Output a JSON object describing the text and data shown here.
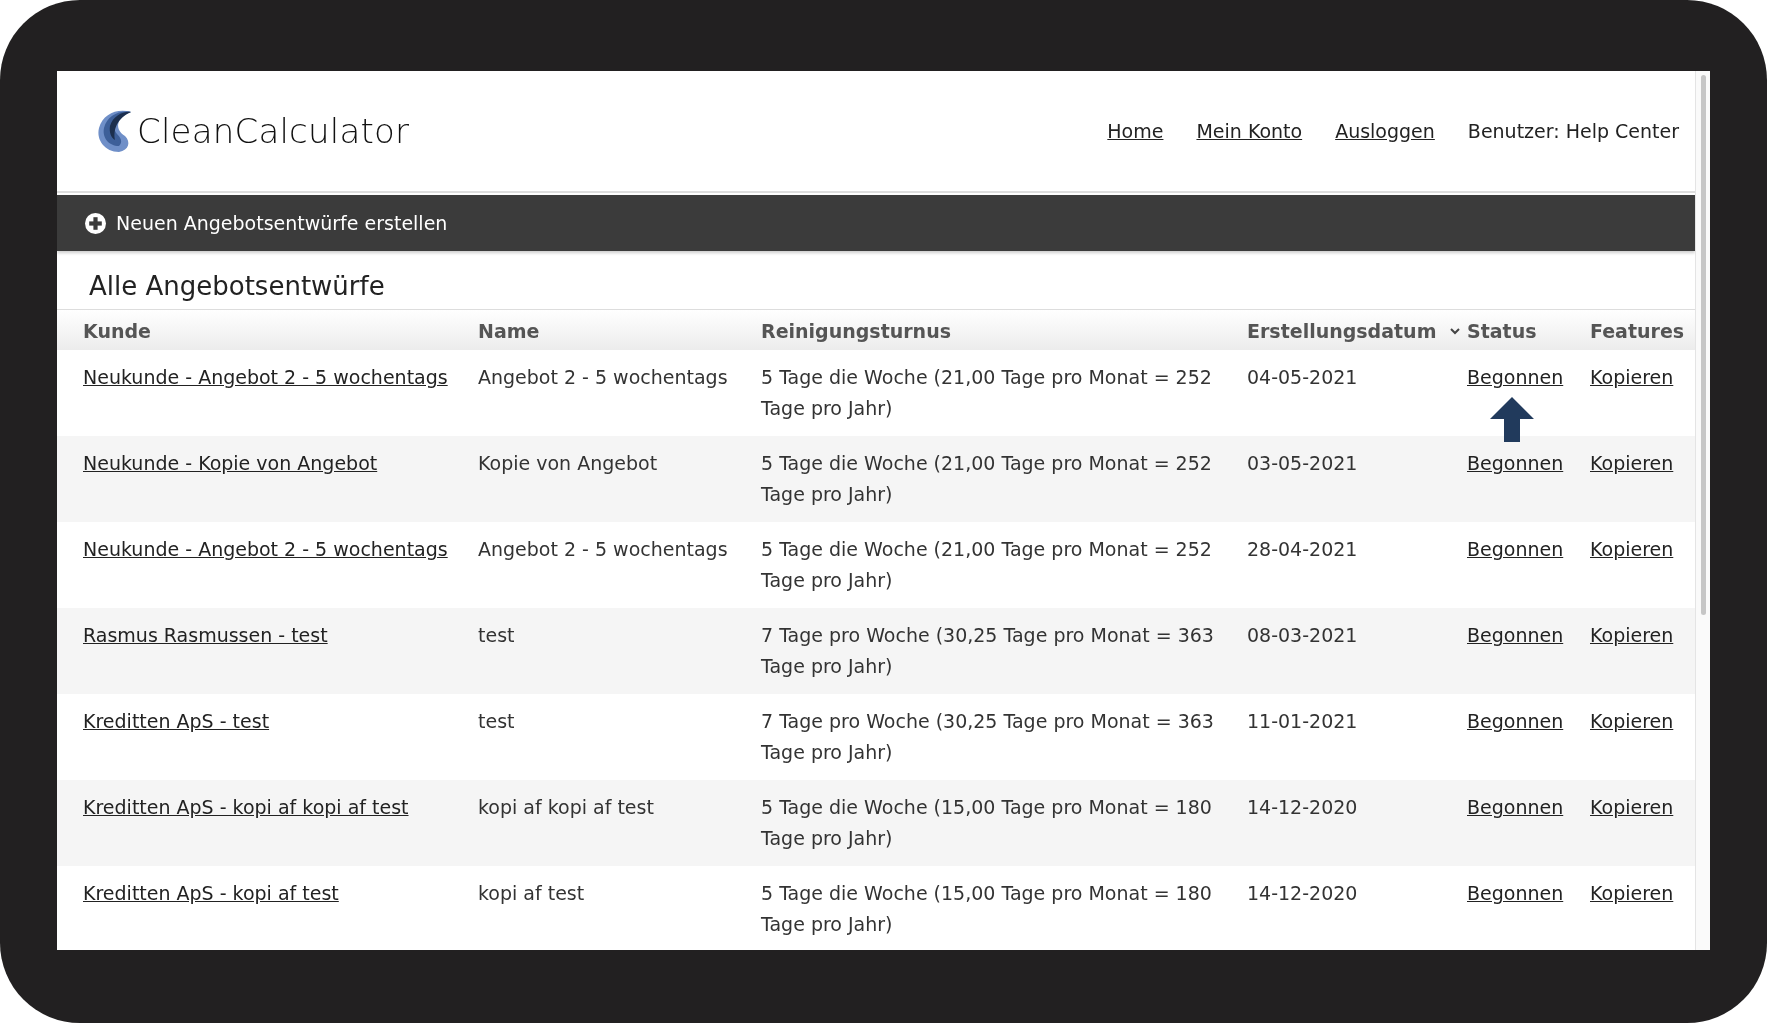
{
  "header": {
    "logo": "CleanCalculator",
    "nav": [
      "Home",
      "Mein Konto",
      "Ausloggen"
    ],
    "user": "Benutzer: Help Center"
  },
  "action_bar": {
    "label": "Neuen Angebotsentwürfe erstellen"
  },
  "section_title": "Alle Angebotsentwürfe",
  "table": {
    "columns": [
      {
        "label": "Kunde",
        "sorted": false
      },
      {
        "label": "Name",
        "sorted": false
      },
      {
        "label": "Reinigungsturnus",
        "sorted": false
      },
      {
        "label": "Erstellungsdatum",
        "sorted": true
      },
      {
        "label": "Status",
        "sorted": false
      },
      {
        "label": "Features",
        "sorted": false
      }
    ],
    "rows": [
      {
        "kunde": "Neukunde - Angebot 2 - 5 wochentags",
        "name": "Angebot 2 - 5 wochentags",
        "turnus": "5 Tage die Woche (21,00 Tage pro Monat = 252 Tage pro Jahr)",
        "datum": "04-05-2021",
        "status": "Begonnen",
        "feature": "Kopieren",
        "pointed": true
      },
      {
        "kunde": "Neukunde - Kopie von Angebot",
        "name": "Kopie von Angebot",
        "turnus": "5 Tage die Woche (21,00 Tage pro Monat = 252 Tage pro Jahr)",
        "datum": "03-05-2021",
        "status": "Begonnen",
        "feature": "Kopieren",
        "pointed": false
      },
      {
        "kunde": "Neukunde - Angebot 2 - 5 wochentags",
        "name": "Angebot 2 - 5 wochentags",
        "turnus": "5 Tage die Woche (21,00 Tage pro Monat = 252 Tage pro Jahr)",
        "datum": "28-04-2021",
        "status": "Begonnen",
        "feature": "Kopieren",
        "pointed": false
      },
      {
        "kunde": "Rasmus Rasmussen - test",
        "name": "test",
        "turnus": "7 Tage pro Woche (30,25 Tage pro Monat = 363 Tage pro Jahr)",
        "datum": "08-03-2021",
        "status": "Begonnen",
        "feature": "Kopieren",
        "pointed": false
      },
      {
        "kunde": "Kreditten ApS - test",
        "name": "test",
        "turnus": "7 Tage pro Woche (30,25 Tage pro Monat = 363 Tage pro Jahr)",
        "datum": "11-01-2021",
        "status": "Begonnen",
        "feature": "Kopieren",
        "pointed": false
      },
      {
        "kunde": "Kreditten ApS - kopi af kopi af test",
        "name": "kopi af kopi af test",
        "turnus": "5 Tage die Woche (15,00 Tage pro Monat = 180 Tage pro Jahr)",
        "datum": "14-12-2020",
        "status": "Begonnen",
        "feature": "Kopieren",
        "pointed": false
      },
      {
        "kunde": "Kreditten ApS - kopi af test",
        "name": "kopi af test",
        "turnus": "5 Tage die Woche (15,00 Tage pro Monat = 180 Tage pro Jahr)",
        "datum": "14-12-2020",
        "status": "Begonnen",
        "feature": "Kopieren",
        "pointed": false
      }
    ]
  }
}
